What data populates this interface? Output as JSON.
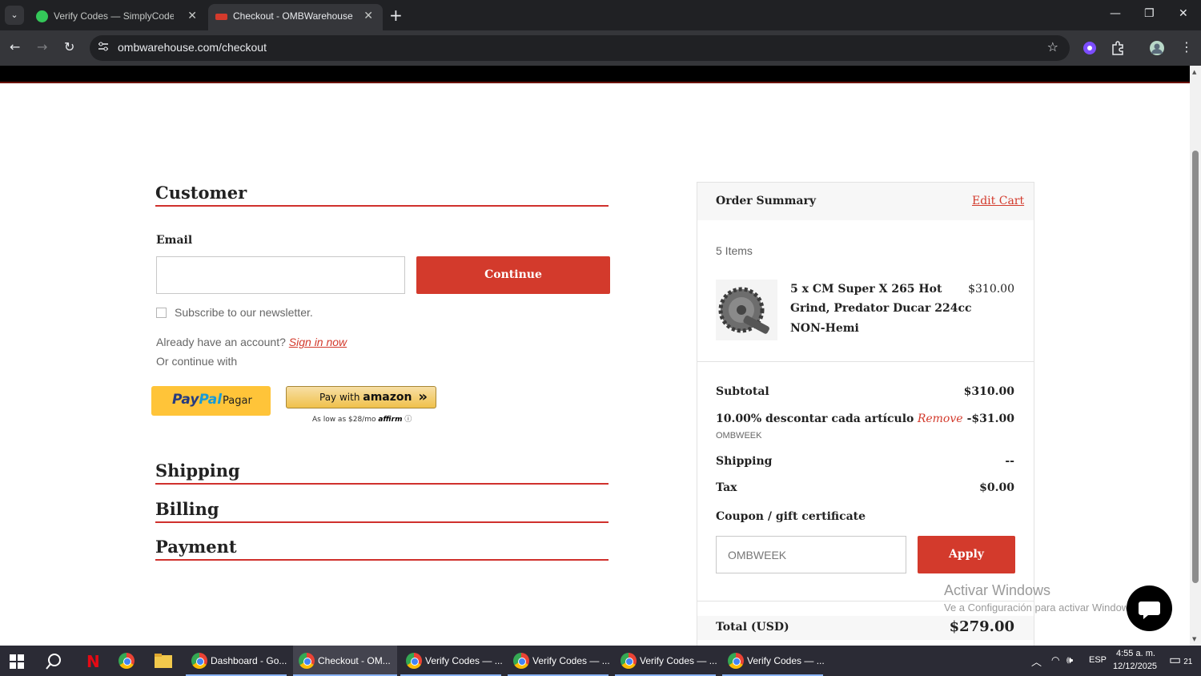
{
  "browser": {
    "tabs": [
      {
        "title": "Verify Codes — SimplyCodes"
      },
      {
        "title": "Checkout - OMBWarehouse.com"
      }
    ],
    "url": "ombwarehouse.com/checkout"
  },
  "checkout": {
    "customer_heading": "Customer",
    "email_label": "Email",
    "continue_label": "Continue",
    "newsletter_label": "Subscribe to our newsletter.",
    "account_prompt": "Already have an account?",
    "sign_in_link": "Sign in now",
    "continue_with": "Or continue with",
    "paypal_label": "Pagar",
    "amazon_prefix": "Pay with",
    "amazon_brand": "amazon",
    "affirm_text": "As low as $28/mo",
    "affirm_brand": "affirm",
    "shipping_heading": "Shipping",
    "billing_heading": "Billing",
    "payment_heading": "Payment"
  },
  "summary": {
    "title": "Order Summary",
    "edit_cart": "Edit Cart",
    "item_count": "5 Items",
    "product_name_1": "5 x CM Super X 265 Hot",
    "product_name_2": "Grind, Predator Ducar 224cc",
    "product_name_3": "NON-Hemi",
    "product_price": "$310.00",
    "subtotal_label": "Subtotal",
    "subtotal_value": "$310.00",
    "discount_label": "10.00% descontar cada artículo",
    "discount_remove": "Remove",
    "discount_value": "-$31.00",
    "discount_code": "OMBWEEK",
    "shipping_label": "Shipping",
    "shipping_value": "--",
    "tax_label": "Tax",
    "tax_value": "$0.00",
    "coupon_label": "Coupon / gift certificate",
    "coupon_value": "OMBWEEK",
    "apply_label": "Apply",
    "total_label": "Total (USD)",
    "total_value": "$279.00"
  },
  "watermark": {
    "line1": "Activar Windows",
    "line2": "Ve a Configuración para activar Windows."
  },
  "taskbar": {
    "apps": [
      {
        "label": "Dashboard - Go..."
      },
      {
        "label": "Checkout - OM..."
      },
      {
        "label": "Verify Codes — ..."
      },
      {
        "label": "Verify Codes — ..."
      },
      {
        "label": "Verify Codes — ..."
      },
      {
        "label": "Verify Codes — ..."
      }
    ],
    "language": "ESP",
    "time": "4:55 a. m.",
    "date": "12/12/2025",
    "notifications": "21"
  },
  "colors": {
    "accent": "#d33a2c",
    "paypal": "#ffc439",
    "amazon": "#f0c14b"
  }
}
